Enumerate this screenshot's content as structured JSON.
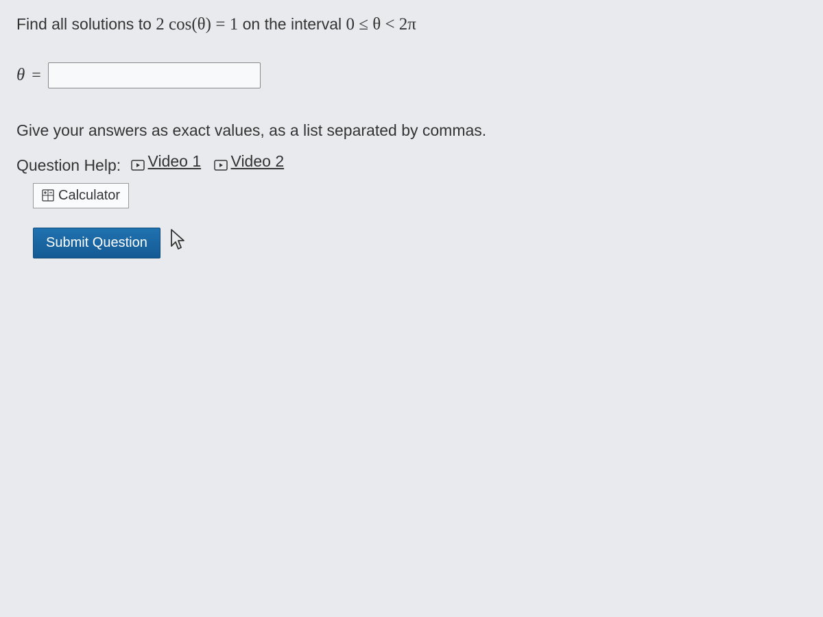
{
  "question": {
    "prefix": "Find all solutions to ",
    "equation_lhs": "2 cos(θ)",
    "equation_op": " = ",
    "equation_rhs": "1",
    "interval_prefix": " on the interval ",
    "interval": "0 ≤ θ < 2π"
  },
  "answer": {
    "theta": "θ",
    "equals": "=",
    "value": ""
  },
  "instruction": "Give your answers as exact values, as a list separated by commas.",
  "help": {
    "label": "Question Help:",
    "video1": "Video 1",
    "video2": "Video 2"
  },
  "calculator": {
    "label": "Calculator"
  },
  "submit": {
    "label": "Submit Question"
  }
}
